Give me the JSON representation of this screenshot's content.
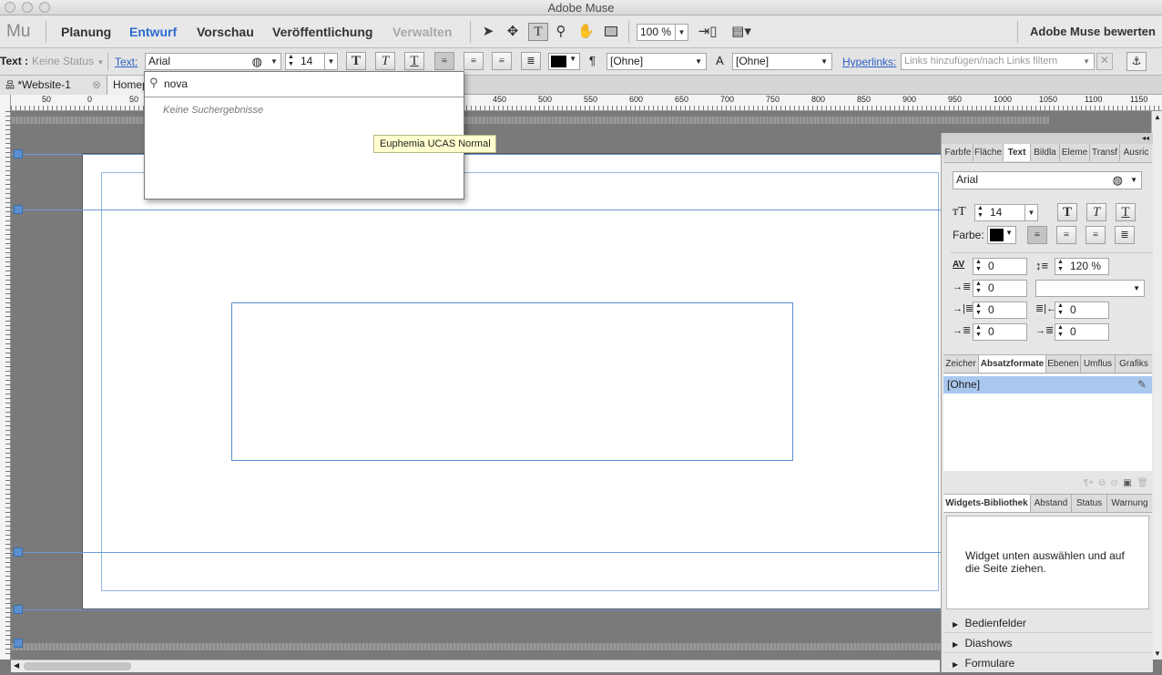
{
  "app": {
    "title": "Adobe Muse",
    "logo": "Mu"
  },
  "menu": {
    "tabs": [
      "Planung",
      "Entwurf",
      "Vorschau",
      "Veröffentlichung",
      "Verwalten"
    ],
    "active_tab": "Entwurf",
    "zoom": "100 %",
    "rate_label": "Adobe Muse bewerten"
  },
  "control": {
    "text_label": "Text :",
    "status_value": "Keine Status",
    "text_link": "Text:",
    "font_value": "Arial",
    "size_value": "14",
    "style_dropdown_1": "[Ohne]",
    "style_dropdown_2": "[Ohne]",
    "hyperlinks_label": "Hyperlinks:",
    "hyperlinks_placeholder": "Links hinzufügen/nach Links filtern"
  },
  "doc_tabs": [
    {
      "label": "*Website-1"
    },
    {
      "label": "Homep"
    }
  ],
  "ruler": {
    "ticks": [
      "50",
      "0",
      "50",
      "450",
      "500",
      "550",
      "600",
      "650",
      "700",
      "750",
      "800",
      "850",
      "900",
      "950",
      "1000",
      "1050",
      "1100",
      "1150"
    ]
  },
  "font_menu": {
    "search_value": "nova",
    "no_results": "Keine Suchergebnisse",
    "tooltip": "Euphemia UCAS Normal"
  },
  "panel": {
    "top_tabs": [
      "Farbfe",
      "Fläche",
      "Text",
      "Bildla",
      "Eleme",
      "Transf",
      "Ausric"
    ],
    "active_top_tab": "Text",
    "font_value": "Arial",
    "size_value": "14",
    "color_label": "Farbe:",
    "tracking_value": "0",
    "leading_value": "120 %",
    "indent_value": "0",
    "left_indent": "0",
    "right_indent": "0",
    "space_before": "0",
    "space_after": "0",
    "mid_tabs": [
      "Zeicher",
      "Absatzformate",
      "Ebenen",
      "Umflus",
      "Grafiks"
    ],
    "active_mid_tab": "Absatzformate",
    "style_item": "[Ohne]",
    "bottom_tabs": [
      "Widgets-Bibliothek",
      "Abstand",
      "Status",
      "Warnung"
    ],
    "active_bottom_tab": "Widgets-Bibliothek",
    "widget_hint": "Widget unten auswählen und auf die Seite ziehen.",
    "sections": [
      "Bedienfelder",
      "Diashows",
      "Formulare"
    ]
  }
}
